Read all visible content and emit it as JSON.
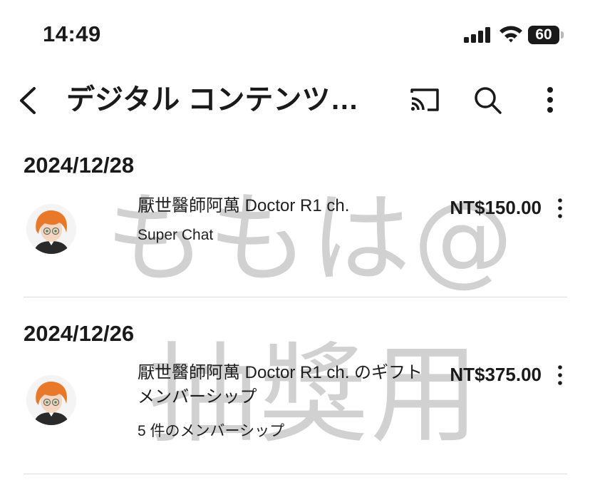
{
  "status_bar": {
    "time": "14:49",
    "battery": "60",
    "battery_level": 0.6
  },
  "toolbar": {
    "title": "デジタル コンテンツ…",
    "icons": [
      "back-icon",
      "cast-icon",
      "search-icon",
      "more-vert-icon"
    ]
  },
  "watermark": {
    "line1": "ももは@",
    "line2": "抽獎用"
  },
  "purchases": [
    {
      "date": "2024/12/28",
      "title": "厭世醫師阿萬 Doctor R1 ch.",
      "subtitle": "Super Chat",
      "price": "NT$150.00"
    },
    {
      "date": "2024/12/26",
      "title": "厭世醫師阿萬 Doctor R1 ch. のギフト メンバーシップ",
      "subtitle": "5 件のメンバーシップ",
      "price": "NT$375.00"
    }
  ],
  "colors": {
    "text": "#1a1a1a",
    "divider": "#dcdcdc",
    "watermark": "#c9c9c9",
    "avatar_hair": "#e8792b"
  }
}
